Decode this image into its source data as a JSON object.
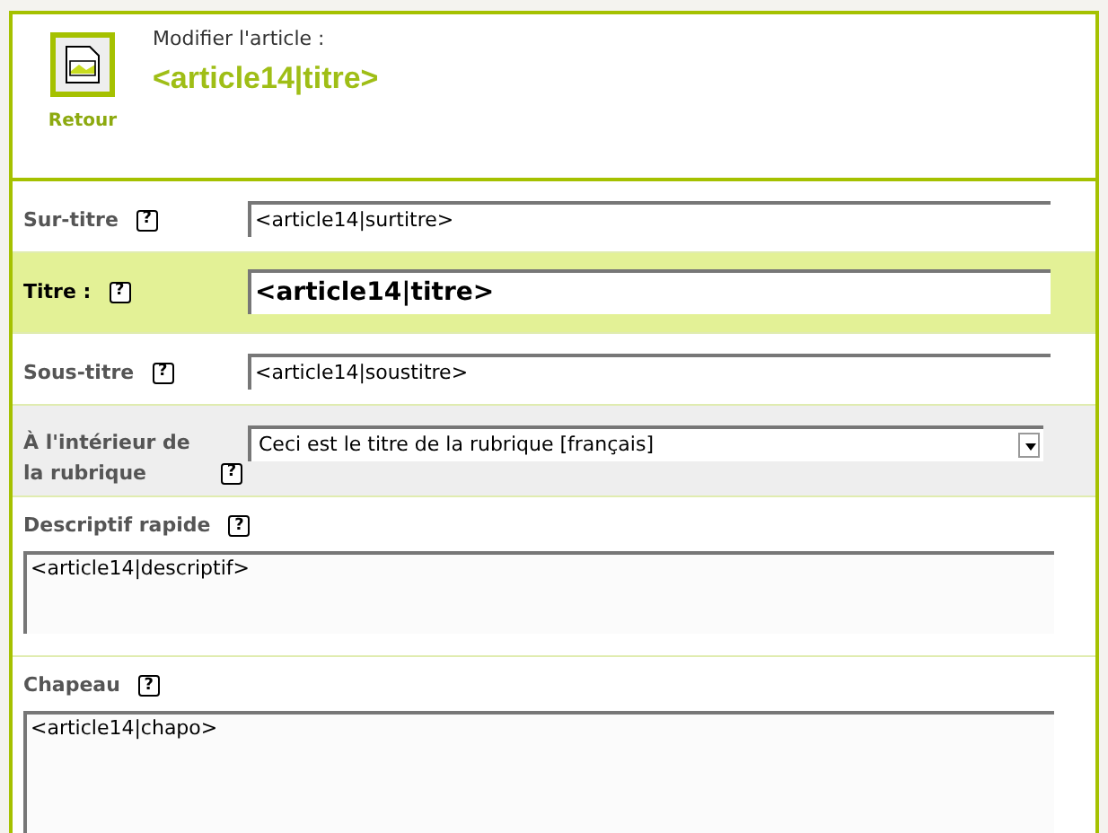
{
  "header": {
    "back_label": "Retour",
    "subtitle": "Modifier l'article :",
    "title": "<article14|titre>"
  },
  "fields": [
    {
      "kind": "text",
      "label": "Sur-titre",
      "help": "?",
      "value": "<article14|surtitre>",
      "highlighted": false
    },
    {
      "kind": "title",
      "label": "Titre :",
      "help": "?",
      "value": "<article14|titre>",
      "highlighted": true
    },
    {
      "kind": "text",
      "label": "Sous-titre",
      "help": "?",
      "value": "<article14|soustitre>",
      "highlighted": false
    },
    {
      "kind": "select",
      "label": "À l'intérieur de la rubrique",
      "help": "?",
      "value": "Ceci est le titre de la rubrique [français]",
      "highlighted": false
    },
    {
      "kind": "textarea",
      "label": "Descriptif rapide",
      "help": "?",
      "value": "<article14|descriptif>",
      "highlighted": false
    },
    {
      "kind": "textarea_large",
      "label": "Chapeau",
      "help": "?",
      "value": "<article14|chapo>",
      "highlighted": false
    }
  ]
}
